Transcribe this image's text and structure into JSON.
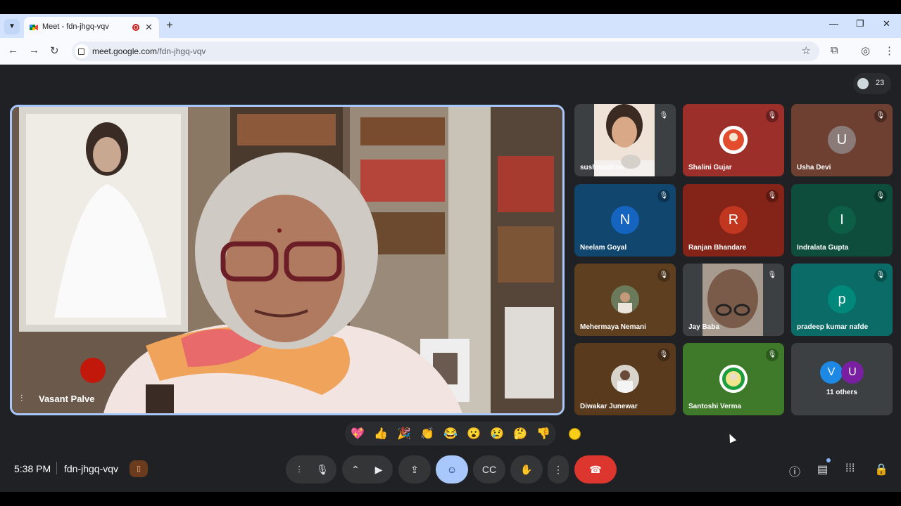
{
  "browser": {
    "tab_title": "Meet - fdn-jhgq-vqv",
    "tab_search_icon": "chevron-down-icon",
    "new_tab_label": "+",
    "url_domain": "meet.google.com",
    "url_path": "/fdn-jhgq-vqv",
    "window_controls": [
      "minimize",
      "restore",
      "close"
    ]
  },
  "meeting": {
    "participant_count": "23",
    "main_speaker": "Vasant Palve",
    "time": "5:38 PM",
    "code": "fdn-jhgq-vqv"
  },
  "tiles": [
    {
      "name": "sushmastroo",
      "type": "video",
      "muted": true
    },
    {
      "name": "Shalini Gujar",
      "type": "photo",
      "muted": true,
      "bg": "#9d2f2a"
    },
    {
      "name": "Usha Devi",
      "type": "letter",
      "letter": "U",
      "muted": true,
      "bg": "#6e4032",
      "avatar_bg": "#8a7a78"
    },
    {
      "name": "Neelam Goyal",
      "type": "letter",
      "letter": "N",
      "muted": true,
      "bg": "#11466e",
      "avatar_bg": "#1565c0"
    },
    {
      "name": "Ranjan Bhandare",
      "type": "letter",
      "letter": "R",
      "muted": true,
      "bg": "#842317",
      "avatar_bg": "#c0361f"
    },
    {
      "name": "Indralata Gupta",
      "type": "letter",
      "letter": "I",
      "muted": true,
      "bg": "#0e4d3b",
      "avatar_bg": "#0c5e45"
    },
    {
      "name": "Mehermaya Nemani",
      "type": "photo",
      "muted": true,
      "bg": "#5e3f1f"
    },
    {
      "name": "Jay Baba",
      "type": "video",
      "muted": true
    },
    {
      "name": "pradeep kumar nafde",
      "type": "letter",
      "letter": "p",
      "muted": true,
      "bg": "#0a6b67",
      "avatar_bg": "#00897b"
    },
    {
      "name": "Diwakar Junewar",
      "type": "photo",
      "muted": true,
      "bg": "#5a3a1d"
    },
    {
      "name": "Santoshi Verma",
      "type": "photo",
      "muted": true,
      "bg": "#3f7a2a"
    }
  ],
  "others": {
    "label": "11 others",
    "avatars": [
      {
        "letter": "V",
        "bg": "#1e88e5"
      },
      {
        "letter": "U",
        "bg": "#7b1fa2"
      }
    ]
  },
  "reactions": [
    "💖",
    "👍",
    "🎉",
    "👏",
    "😂",
    "😮",
    "😢",
    "🤔",
    "👎"
  ],
  "controls": {
    "left": [
      "audio-levels",
      "mic",
      "more-options-chevron",
      "camera",
      "present",
      "emoji",
      "captions",
      "raise-hand",
      "more",
      "end-call"
    ],
    "right": [
      "info",
      "chat",
      "activities",
      "host-controls"
    ]
  }
}
